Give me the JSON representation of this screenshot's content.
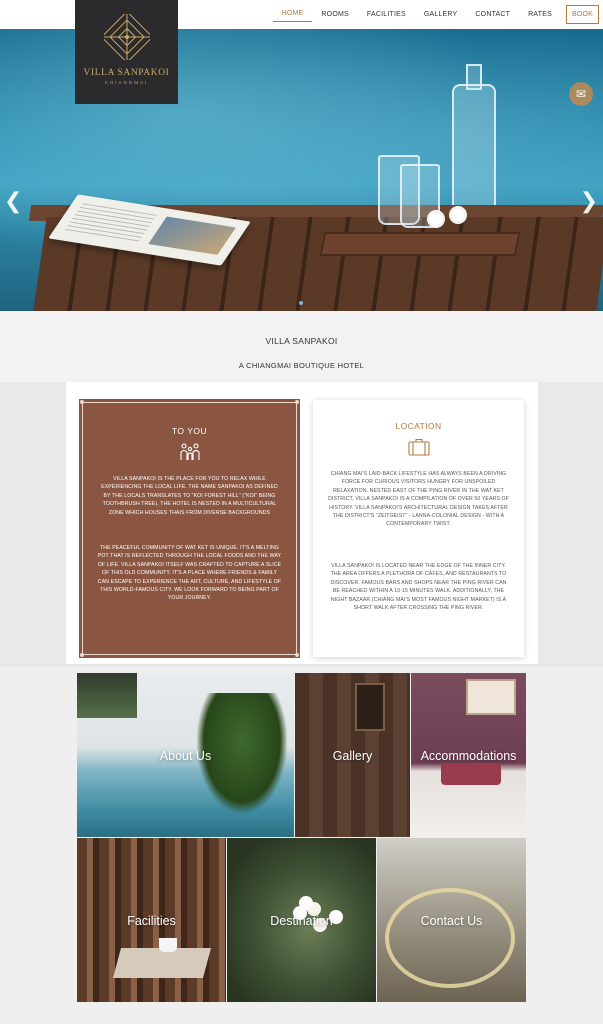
{
  "logo": {
    "brand": "VILLA SANPAKOI",
    "city": "CHIANGMAI",
    "color": "#c9a86a"
  },
  "nav": {
    "items": [
      "HOME",
      "ROOMS",
      "FACILITIES",
      "GALLERY",
      "CONTACT",
      "RATES"
    ],
    "book": "BOOK",
    "accent": "#b27b3e"
  },
  "hero": {
    "prev_icon": "chevron-left-icon",
    "next_icon": "chevron-right-icon",
    "messenger_icon": "messenger-icon",
    "slide_indicator": "slide-dot"
  },
  "intro": {
    "title": "VILLA SANPAKOI",
    "subtitle": "A CHIANGMAI BOUTIQUE HOTEL"
  },
  "to_you": {
    "heading": "TO YOU",
    "icon": "family-icon",
    "para1": "VILLA SANPAKOI IS THE PLACE FOR YOU TO RELAX WHILE EXPERIENCING THE LOCAL LIFE. THE NAME SANPAKOI AS DEFINED BY THE LOCALS TRANSLATES TO \"KOI FOREST HILL\" (\"KOI\" BEING TOOTHBRUSH TREE). THE HOTEL IS NESTED IN A MULTICULTURAL ZONE WHICH HOUSES THAIS FROM DIVERSE BACKGROUNDS",
    "para2": "THE PEACEFUL COMMUNITY OF WAT KET IS UNIQUE. IT'S A MELTING POT THAT IS REFLECTED THROUGH THE LOCAL FOODS AND THE WAY OF LIFE. VILLA SANPAKOI ITSELF WAS CRAFTED TO CAPTURE A SLICE OF THIS OLD COMMUNITY. IT'S A PLACE WHERE FRIENDS & FAMILY CAN ESCAPE TO EXPERIENCE THE ART, CULTURE, AND LIFESTYLE OF THIS WORLD-FAMOUS CITY. WE LOOK FORWARD TO BEING PART OF YOUR JOURNEY.",
    "color": "#8a5642"
  },
  "location": {
    "heading": "LOCATION",
    "icon": "luggage-icon",
    "para1": "CHIANG MAI'S LAID-BACK LIFESTYLE HAS ALWAYS BEEN A DRIVING FORCE FOR CURIOUS VISITORS HUNGRY FOR UNSPOILED RELAXATION. NESTED EAST OF THE PING RIVER IN THE WAT KET DISTRICT, VILLA SANPAKOI IS A COMPILATION OF OVER 50 YEARS OF HISTORY. VILLA SANPAKOI'S ARCHITECTURAL DESIGN TAKES AFTER THE DISTRICT'S \"ZEITGEIST\" - LANNA-COLONIAL DESIGN - WITH A CONTEMPORARY TWIST.",
    "para2": "VILLA SANPAKOI IS LOCATED NEAR THE EDGE OF THE INNER CITY. THE AREA OFFERS A PLETHORA OF CAFES, AND RESTAURANTS TO DISCOVER. FAMOUS BARS AND SHOPS NEAR THE PING RIVER CAN BE REACHED WITHIN A 10-15 MINUTES WALK. ADDITIONALLY, THE NIGHT BAZAAR (CHIANG MAI'S MOST FAMOUS NIGHT MARKET) IS A SHORT WALK AFTER CROSSING THE PING RIVER."
  },
  "tiles": {
    "about": "About Us",
    "gallery": "Gallery",
    "accommodations": "Accommodations",
    "facilities": "Facilities",
    "destination": "Destination",
    "contact": "Contact Us"
  }
}
